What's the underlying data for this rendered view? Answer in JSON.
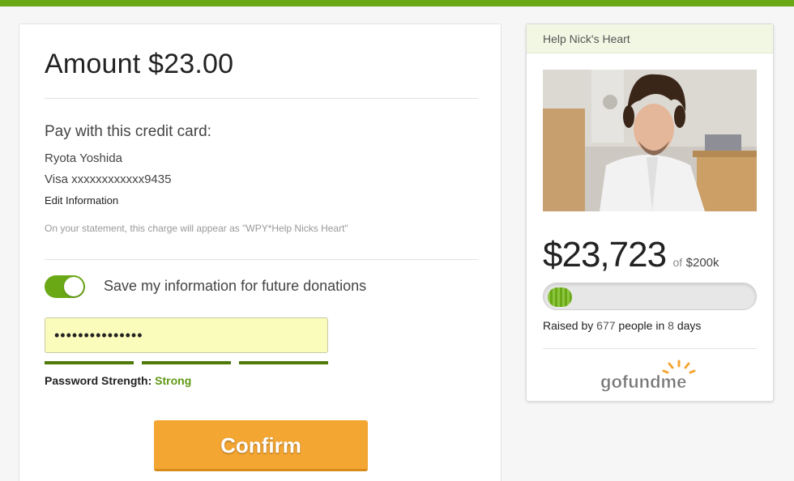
{
  "payment": {
    "amount_title": "Amount $23.00",
    "pay_label": "Pay with this credit card:",
    "cardholder": "Ryota Yoshida",
    "card_number": "Visa xxxxxxxxxxxx9435",
    "edit_link": "Edit Information",
    "statement_note": "On your statement, this charge will appear as \"WPY*Help Nicks Heart\"",
    "save_toggle_on": true,
    "save_label": "Save my information for future donations",
    "password_value": "•••••••••••••••",
    "password_strength_label": "Password Strength:",
    "password_strength_value": "Strong",
    "confirm_label": "Confirm"
  },
  "campaign": {
    "title": "Help Nick's Heart",
    "raised": "$23,723",
    "of": "of",
    "goal": "$200k",
    "progress_fraction": 0.12,
    "raised_by_prefix": "Raised by",
    "people_count": "677",
    "people_mid": "people in",
    "days": "8",
    "days_suffix": "days",
    "logo_text": "gofundme"
  },
  "colors": {
    "brand_green": "#6aa815",
    "confirm_orange": "#f4a633",
    "strength_green": "#5f9813"
  }
}
